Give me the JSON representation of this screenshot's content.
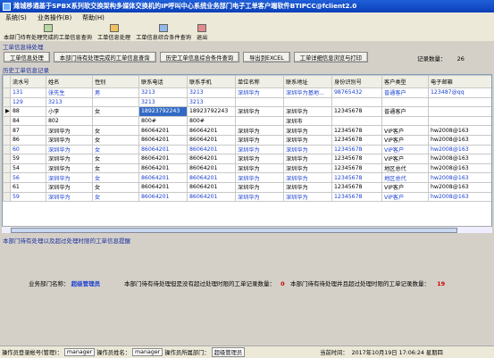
{
  "window": {
    "title": "潍城移通基于SPBX系列软交换架构多媒体交换机的IP呼叫中心系统业务部门电子工单客户端软件BTIPCC@fclient2.0"
  },
  "menu": [
    "系统(S)",
    "业务操作(B)",
    "帮助(H)"
  ],
  "toolbar": [
    "本部门待有处理完成的工单信息查询",
    "工单信息处理",
    "工单信息综合条件查询",
    "退出"
  ],
  "section": {
    "pending_label": "工单信息待处理",
    "history_label": "历史工单信息记录"
  },
  "buttons": [
    "工单信息处理",
    "本部门待有处理完成的工单信息查询",
    "历史工单信息综合条件查询",
    "导出到EXCEL",
    "工单详细信息浏览与打印"
  ],
  "record_count": {
    "label": "记录数量：",
    "value": "26"
  },
  "table": {
    "columns": [
      "流水号",
      "姓名",
      "性别",
      "联系电话",
      "联系手机",
      "单位名称",
      "联系地址",
      "身份识别号",
      "客户类型",
      "电子邮箱"
    ],
    "rows": [
      {
        "blue": true,
        "cells": [
          "131",
          "张先生",
          "男",
          "3213",
          "3213",
          "深圳华为",
          "深圳华为基地...",
          "98765432",
          "普通客户",
          "123487@qq"
        ]
      },
      {
        "blue": true,
        "cells": [
          "129",
          "3213",
          "",
          "3213",
          "3213",
          "",
          "",
          "",
          "",
          ""
        ]
      },
      {
        "blue": false,
        "current": true,
        "cells": [
          "88",
          "小李",
          "女",
          "18923792243",
          "18923792243",
          "深圳华为",
          "深圳华为",
          "12345678",
          "普通客户",
          ""
        ]
      },
      {
        "blue": false,
        "cells": [
          "84",
          "802",
          "",
          "800#",
          "800#",
          "",
          "深圳市",
          "",
          "",
          ""
        ]
      },
      {
        "blue": false,
        "cells": [
          "87",
          "深圳华为",
          "女",
          "86064201",
          "86064201",
          "深圳华为",
          "深圳华为",
          "12345678",
          "VIP客户",
          "hw2008@163"
        ]
      },
      {
        "blue": false,
        "cells": [
          "86",
          "深圳华为",
          "女",
          "86064201",
          "86064201",
          "深圳华为",
          "深圳华为",
          "12345678",
          "VIP客户",
          "hw2008@163"
        ]
      },
      {
        "blue": true,
        "cells": [
          "60",
          "深圳华为",
          "女",
          "86064201",
          "86064201",
          "深圳华为",
          "深圳华为",
          "12345678",
          "VIP客户",
          "hw2008@163"
        ]
      },
      {
        "blue": false,
        "cells": [
          "59",
          "深圳华为",
          "女",
          "86064201",
          "86064201",
          "深圳华为",
          "深圳华为",
          "12345678",
          "VIP客户",
          "hw2008@163"
        ]
      },
      {
        "blue": false,
        "cells": [
          "54",
          "深圳华为",
          "女",
          "86064201",
          "86064201",
          "深圳华为",
          "深圳华为",
          "12345678",
          "地区总代",
          "hw2008@163"
        ]
      },
      {
        "blue": true,
        "cells": [
          "56",
          "深圳华为",
          "女",
          "86064201",
          "86064201",
          "深圳华为",
          "深圳华为",
          "12345678",
          "地区总代",
          "hw2008@163"
        ]
      },
      {
        "blue": false,
        "cells": [
          "61",
          "深圳华为",
          "女",
          "86064201",
          "86064201",
          "深圳华为",
          "深圳华为",
          "12345678",
          "VIP客户",
          "hw2008@163"
        ]
      },
      {
        "blue": true,
        "cells": [
          "59",
          "深圳华为",
          "女",
          "86064201",
          "86064201",
          "深圳华为",
          "深圳华为",
          "12345678",
          "VIP客户",
          "hw2008@163"
        ]
      }
    ]
  },
  "lower": {
    "title": "本部门待有处理以及超过处理时限的工单信息提醒",
    "dept_label": "业务部门名称：",
    "dept_value": "超级管理员",
    "pending_label": "本部门待有待处理但是没有超过处理时限的工单记录数量：",
    "pending_value": "0",
    "overdue_label": "本部门待有待处理并且超过处理时限的工单记录数量：",
    "overdue_value": "19"
  },
  "status": {
    "account_label": "操作员登录帐号(管理)：",
    "account_value": "manager",
    "name_label": "操作员姓名：",
    "name_value": "manager",
    "dept_label": "操作员所属部门：",
    "dept_value": "超级管理员",
    "time_label": "当前时间：",
    "time_value": "2017年10月19日 17:06:24 星期四"
  },
  "colors": {
    "title_blue": "#0b3fb8",
    "link_blue": "#1b2fa0",
    "row_blue": "#1a3fd0",
    "selected": "#316ac5",
    "highlight_red": "#d00000"
  }
}
